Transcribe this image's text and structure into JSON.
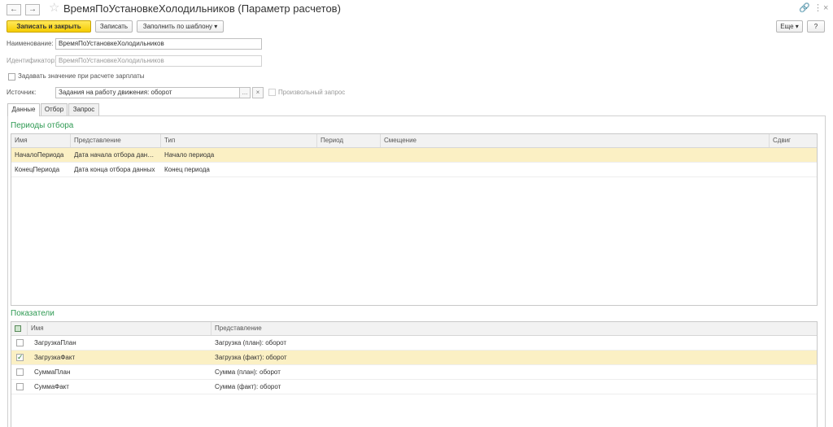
{
  "window": {
    "title": "ВремяПоУстановкеХолодильников (Параметр расчетов)",
    "back": "←",
    "forward": "→",
    "star": "☆",
    "link": "🔗",
    "more": "⋮",
    "close": "×"
  },
  "toolbar": {
    "save_close": "Записать и закрыть",
    "save": "Записать",
    "fill_template": "Заполнить по шаблону",
    "dropdown_arrow": "▾",
    "more": "Еще",
    "help": "?"
  },
  "form": {
    "name_label": "Наименование:",
    "name_value": "ВремяПоУстановкеХолодильников",
    "id_label": "Идентификатор:",
    "id_value": "ВремяПоУстановкеХолодильников",
    "set_value_label": "Задавать значение при расчете зарплаты",
    "source_label": "Источник:",
    "source_value": "Задания на работу движения: оборот",
    "source_select": "...",
    "source_clear": "×",
    "arbitrary_query_label": "Произвольный запрос"
  },
  "tabs": [
    "Данные",
    "Отбор",
    "Запрос"
  ],
  "periods": {
    "title": "Периоды отбора",
    "columns": [
      "Имя",
      "Представление",
      "Тип",
      "Период",
      "Смещение",
      "Сдвиг"
    ],
    "rows": [
      {
        "name": "НачалоПериода",
        "repr": "Дата начала отбора дан…",
        "type": "Начало периода",
        "selected": true
      },
      {
        "name": "КонецПериода",
        "repr": "Дата конца отбора данных",
        "type": "Конец периода",
        "selected": false
      }
    ]
  },
  "indicators": {
    "title": "Показатели",
    "columns": [
      "Имя",
      "Представление"
    ],
    "rows": [
      {
        "checked": false,
        "name": "ЗагрузкаПлан",
        "repr": "Загрузка (план): оборот",
        "selected": false
      },
      {
        "checked": true,
        "name": "ЗагрузкаФакт",
        "repr": "Загрузка (факт): оборот",
        "selected": true
      },
      {
        "checked": false,
        "name": "СуммаПлан",
        "repr": "Сумма (план): оборот",
        "selected": false
      },
      {
        "checked": false,
        "name": "СуммаФакт",
        "repr": "Сумма (факт): оборот",
        "selected": false
      }
    ]
  },
  "colors": {
    "primary_button": "#f5cd00",
    "section_title": "#2f9a53",
    "selected_row": "#fbf0c4"
  }
}
